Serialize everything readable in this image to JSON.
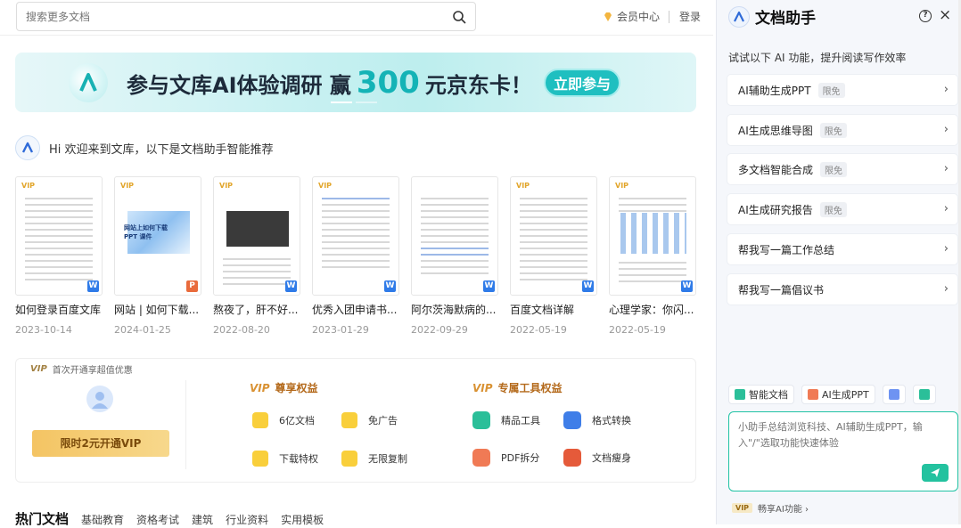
{
  "search": {
    "placeholder": "搜索更多文档"
  },
  "header": {
    "vip_center": "会员中心",
    "login": "登录"
  },
  "banner": {
    "text_before": "参与文库AI体验调研 赢",
    "number": "300",
    "text_after": "元京东卡！",
    "button": "立即参与"
  },
  "greeting": "Hi 欢迎来到文库，以下是文档助手智能推荐",
  "docs": [
    {
      "title": "如何登录百度文库",
      "date": "2023-10-14",
      "type": "W"
    },
    {
      "title": "网站 | 如何下载...",
      "date": "2024-01-25",
      "type": "P"
    },
    {
      "title": "熬夜了，肝不好...",
      "date": "2022-08-20",
      "type": "W"
    },
    {
      "title": "优秀入团申请书...",
      "date": "2023-01-29",
      "type": "W"
    },
    {
      "title": "阿尔茨海默病的...",
      "date": "2022-09-29",
      "type": "W"
    },
    {
      "title": "百度文档详解",
      "date": "2022-05-19",
      "type": "W"
    },
    {
      "title": "心理学家：你闪...",
      "date": "2022-05-19",
      "type": "W"
    }
  ],
  "doc_badge": "VIP",
  "thumb_text": {
    "preview": "网站上如何下载PPT 课件"
  },
  "vip": {
    "header_badge": "VIP",
    "header_text": "首次开通享超值优惠",
    "open_button": "限时2元开通VIP",
    "section1_title": "尊享权益",
    "section2_title": "专属工具权益",
    "section_badge": "VIP",
    "perks1": [
      "6亿文档",
      "免广告",
      "下载特权",
      "无限复制"
    ],
    "perks2": [
      "精品工具",
      "格式转换",
      "PDF拆分",
      "文档瘦身"
    ]
  },
  "tabs": {
    "hot": "热门文档",
    "items": [
      "基础教育",
      "资格考试",
      "建筑",
      "行业资料",
      "实用模板"
    ]
  },
  "panel": {
    "title": "文档助手",
    "help_icon": "?",
    "close_icon": "×",
    "intro": "试试以下 AI 功能，提升阅读写作效率",
    "features": [
      {
        "label": "AI辅助生成PPT",
        "tag": "限免"
      },
      {
        "label": "AI生成思维导图",
        "tag": "限免"
      },
      {
        "label": "多文档智能合成",
        "tag": "限免"
      },
      {
        "label": "AI生成研究报告",
        "tag": "限免"
      },
      {
        "label": "帮我写一篇工作总结",
        "tag": ""
      },
      {
        "label": "帮我写一篇倡议书",
        "tag": ""
      }
    ],
    "quick": [
      "智能文档",
      "AI生成PPT"
    ],
    "input_placeholder": "小助手总结浏览科技、AI辅助生成PPT，输入\"/\"选取功能快速体验",
    "footer_badge": "VIP",
    "footer_text": "畅享AI功能 ›"
  }
}
